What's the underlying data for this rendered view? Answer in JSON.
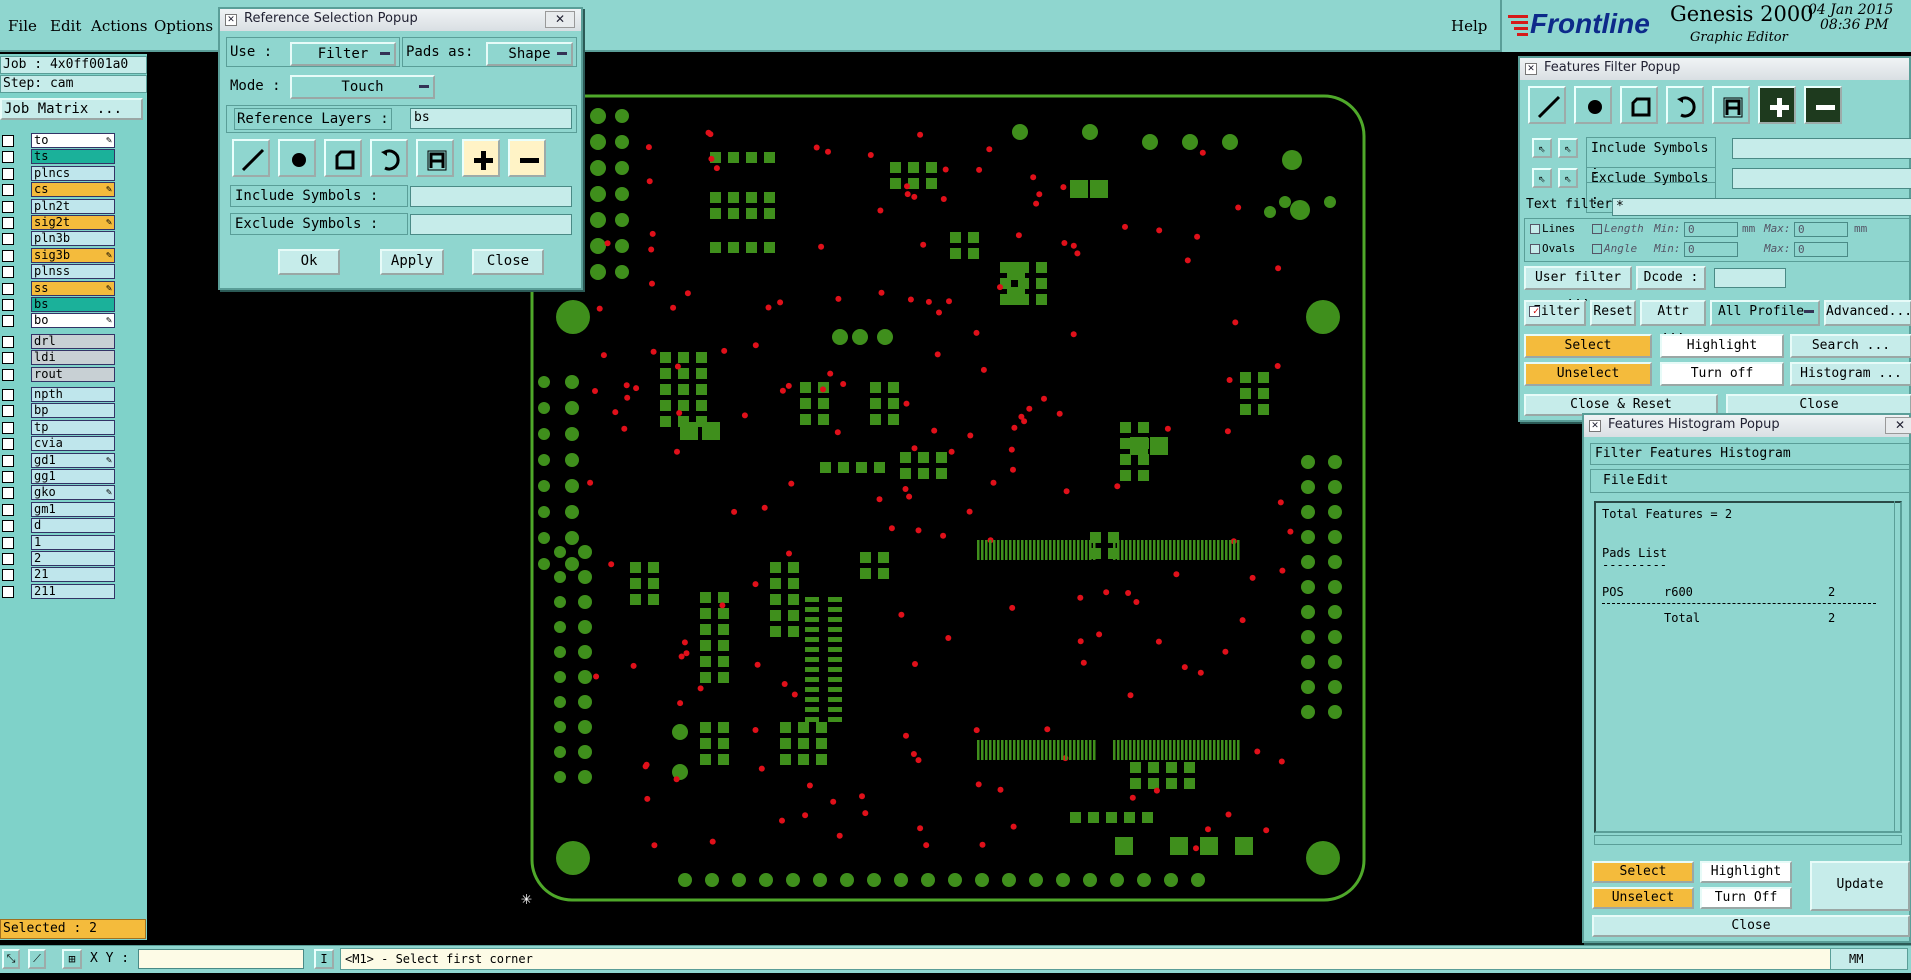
{
  "menubar": {
    "items": [
      "File",
      "Edit",
      "Actions",
      "Options"
    ],
    "help": "Help",
    "brand": "Frontline",
    "product": "Genesis 2000",
    "subtitle": "Graphic Editor",
    "date": "04 Jan 2015",
    "time": "08:36 PM"
  },
  "job": {
    "job_line": "Job : 4x0ff001a0",
    "step_line": "Step: cam",
    "matrix_button": "Job Matrix ..."
  },
  "layers": [
    {
      "name": "to",
      "style": "wht",
      "edit": true
    },
    {
      "name": "ts",
      "style": "sel",
      "edit": false
    },
    {
      "name": "plncs",
      "style": "",
      "edit": false
    },
    {
      "name": "cs",
      "style": "org",
      "edit": true
    },
    {
      "name": "pln2t",
      "style": "",
      "edit": false
    },
    {
      "name": "sig2t",
      "style": "org",
      "edit": true
    },
    {
      "name": "pln3b",
      "style": "",
      "edit": false
    },
    {
      "name": "sig3b",
      "style": "org",
      "edit": true
    },
    {
      "name": "plnss",
      "style": "",
      "edit": false
    },
    {
      "name": "ss",
      "style": "org",
      "edit": true
    },
    {
      "name": "bs",
      "style": "sel",
      "edit": false
    },
    {
      "name": "bo",
      "style": "wht",
      "edit": true
    },
    {
      "name": "drl",
      "style": "gry",
      "edit": false
    },
    {
      "name": "ldi",
      "style": "gry",
      "edit": false
    },
    {
      "name": "rout",
      "style": "gry",
      "edit": false
    },
    {
      "name": "npth",
      "style": "",
      "edit": false
    },
    {
      "name": "bp",
      "style": "",
      "edit": false
    },
    {
      "name": "tp",
      "style": "",
      "edit": false
    },
    {
      "name": "cvia",
      "style": "",
      "edit": false
    },
    {
      "name": "gd1",
      "style": "",
      "edit": true
    },
    {
      "name": "gg1",
      "style": "",
      "edit": false
    },
    {
      "name": "gko",
      "style": "",
      "edit": true
    },
    {
      "name": "gm1",
      "style": "",
      "edit": false
    },
    {
      "name": "d",
      "style": "",
      "edit": false
    },
    {
      "name": "1",
      "style": "",
      "edit": false
    },
    {
      "name": "2",
      "style": "",
      "edit": false
    },
    {
      "name": "21",
      "style": "",
      "edit": false
    },
    {
      "name": "211",
      "style": "",
      "edit": false
    }
  ],
  "status": {
    "selected": "Selected : 2",
    "xy_label": "X Y :",
    "prompt": "<M1> - Select first corner",
    "units": "MM"
  },
  "ref_popup": {
    "title": "Reference Selection Popup",
    "use_label": "Use :",
    "use_value": "Filter",
    "pads_label": "Pads as:",
    "pads_value": "Shape",
    "mode_label": "Mode :",
    "mode_value": "Touch",
    "ref_layers_label": "Reference Layers :",
    "ref_layers_value": "bs",
    "include_label": "Include Symbols :",
    "exclude_label": "Exclude Symbols :",
    "ok": "Ok",
    "apply": "Apply",
    "close": "Close"
  },
  "filter_popup": {
    "title": "Features Filter Popup",
    "include_label": "Include Symbols :",
    "exclude_label": "Exclude Symbols :",
    "text_filter_label": "Text filter",
    "text_filter_value": "*",
    "lines": "Lines",
    "ovals": "Ovals",
    "length": "Length",
    "angle": "Angle",
    "min": "Min:",
    "max": "Max:",
    "min_val": "0",
    "max_val": "0",
    "mm": "mm",
    "user_filter": "User filter ...",
    "dcode": "Dcode :",
    "filter": "Filter",
    "reset": "Reset",
    "attr": "Attr ...",
    "all_profile": "All Profile",
    "advanced": "Advanced...",
    "select": "Select",
    "highlight": "Highlight",
    "search": "Search ...",
    "unselect": "Unselect",
    "turn_off": "Turn off",
    "histogram": "Histogram ...",
    "close_reset": "Close & Reset",
    "close": "Close"
  },
  "hist_popup": {
    "title": "Features Histogram Popup",
    "header": "Filter Features Histogram",
    "file": "File",
    "edit": "Edit",
    "total_features": "Total Features = 2",
    "pads_list": "Pads List",
    "rule": "---------",
    "row_pos": "POS",
    "row_sym": "r600",
    "row_count": "2",
    "total_label": "Total",
    "total_count": "2",
    "select": "Select",
    "highlight": "Highlight",
    "update": "Update",
    "unselect": "Unselect",
    "turn_off": "Turn Off",
    "close": "Close"
  },
  "colors": {
    "panel": "#8fd6cf",
    "field": "#c6ecea",
    "pad_green": "#3f8f1c",
    "outline_green": "#4fa82a",
    "drill_red": "#e0101a",
    "orange": "#f4bb3c"
  }
}
